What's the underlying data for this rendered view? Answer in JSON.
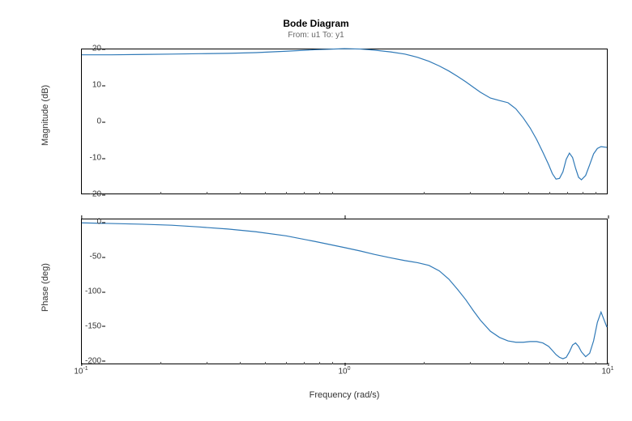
{
  "title": "Bode Diagram",
  "subtitle": "From: u1  To: y1",
  "xlabel": "Frequency (rad/s)",
  "panels": {
    "mag": {
      "ylabel": "Magnitude (dB)",
      "ylim": [
        -20,
        20
      ],
      "yticks": [
        -20,
        -10,
        0,
        10,
        20
      ]
    },
    "phase": {
      "ylabel": "Phase (deg)",
      "ylim": [
        -205,
        5
      ],
      "yticks": [
        -200,
        -150,
        -100,
        -50,
        0
      ]
    }
  },
  "xticks": [
    {
      "label_base": "10",
      "label_exp": "-1",
      "value": 0.1
    },
    {
      "label_base": "10",
      "label_exp": "0",
      "value": 1
    },
    {
      "label_base": "10",
      "label_exp": "1",
      "value": 10
    }
  ],
  "xlim_log10": [
    -1,
    1
  ],
  "chart_data": {
    "type": "line",
    "series": [
      {
        "name": "Magnitude (dB)",
        "x": [
          0.1,
          0.13,
          0.17,
          0.22,
          0.28,
          0.36,
          0.46,
          0.6,
          0.77,
          1.0,
          1.15,
          1.3,
          1.5,
          1.7,
          1.9,
          2.1,
          2.3,
          2.5,
          2.7,
          2.9,
          3.1,
          3.3,
          3.6,
          3.9,
          4.2,
          4.5,
          4.8,
          5.1,
          5.4,
          5.7,
          6.0,
          6.2,
          6.4,
          6.6,
          6.8,
          7.0,
          7.2,
          7.4,
          7.6,
          7.8,
          8.0,
          8.3,
          8.6,
          8.9,
          9.2,
          9.5,
          10.0
        ],
        "y": [
          18.5,
          18.5,
          18.6,
          18.7,
          18.8,
          18.9,
          19.1,
          19.5,
          19.9,
          20.2,
          20.1,
          19.8,
          19.3,
          18.7,
          17.8,
          16.7,
          15.4,
          14.0,
          12.5,
          11.0,
          9.5,
          8.1,
          6.5,
          5.8,
          5.2,
          3.5,
          1.0,
          -1.8,
          -5.0,
          -8.5,
          -12.0,
          -14.5,
          -16.0,
          -15.8,
          -14.0,
          -10.5,
          -8.8,
          -10.0,
          -13.0,
          -15.5,
          -16.2,
          -15.0,
          -12.0,
          -9.0,
          -7.5,
          -7.0,
          -7.2
        ]
      },
      {
        "name": "Phase (deg)",
        "x": [
          0.1,
          0.13,
          0.17,
          0.22,
          0.28,
          0.36,
          0.46,
          0.6,
          0.77,
          1.0,
          1.15,
          1.3,
          1.5,
          1.7,
          1.9,
          2.1,
          2.3,
          2.5,
          2.7,
          2.9,
          3.1,
          3.3,
          3.6,
          3.9,
          4.2,
          4.5,
          4.8,
          5.1,
          5.4,
          5.7,
          6.0,
          6.2,
          6.4,
          6.6,
          6.8,
          7.0,
          7.2,
          7.4,
          7.6,
          7.8,
          8.0,
          8.3,
          8.6,
          8.9,
          9.2,
          9.5,
          10.0
        ],
        "y": [
          0,
          -1,
          -2,
          -3.5,
          -6,
          -9,
          -13,
          -19,
          -27,
          -36,
          -41,
          -46,
          -51,
          -55,
          -58,
          -62,
          -70,
          -82,
          -97,
          -112,
          -128,
          -142,
          -158,
          -167,
          -172,
          -174,
          -174,
          -173,
          -173,
          -175,
          -180,
          -186,
          -192,
          -196,
          -198,
          -196,
          -188,
          -178,
          -175,
          -180,
          -188,
          -195,
          -190,
          -172,
          -145,
          -130,
          -152
        ]
      }
    ],
    "title": "Bode Diagram",
    "xlabel": "Frequency (rad/s)",
    "xscale": "log"
  }
}
